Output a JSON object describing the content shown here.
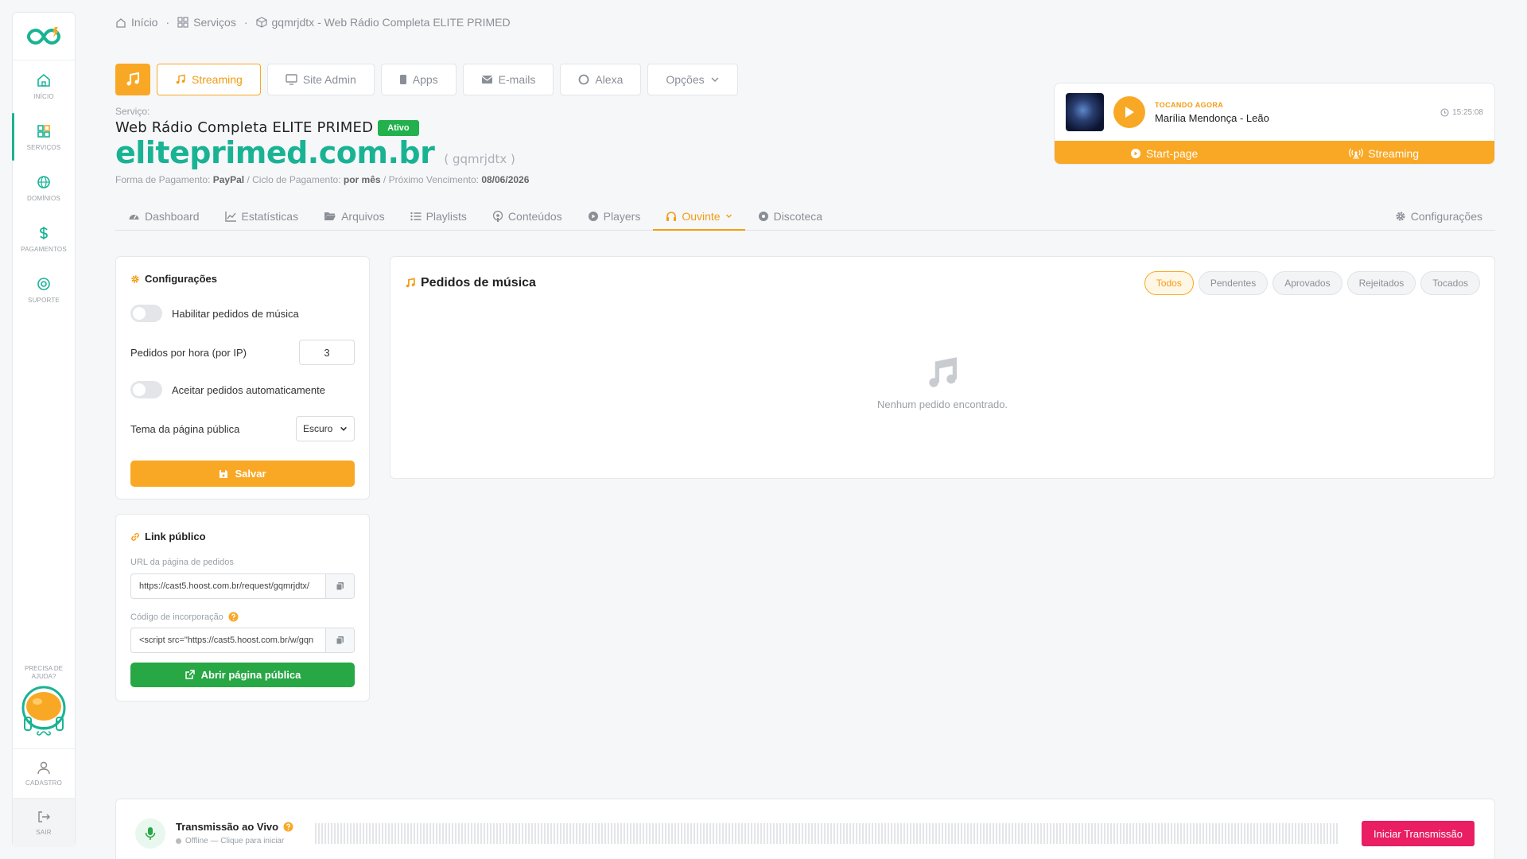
{
  "sidebar": {
    "nav": [
      {
        "label": "INÍCIO",
        "icon": "home-icon"
      },
      {
        "label": "SERVIÇOS",
        "icon": "grid-icon"
      },
      {
        "label": "DOMÍNIOS",
        "icon": "globe-icon"
      },
      {
        "label": "PAGAMENTOS",
        "icon": "dollar-icon"
      },
      {
        "label": "SUPORTE",
        "icon": "lifebuoy-icon"
      }
    ],
    "help_line1": "PRECISA DE",
    "help_line2": "AJUDA?",
    "account_label": "CADASTRO",
    "logout_label": "SAIR"
  },
  "breadcrumb": {
    "home": "Início",
    "services": "Serviços",
    "current": "gqmrjdtx - Web Rádio Completa ELITE PRIMED"
  },
  "service_tabs": {
    "streaming": "Streaming",
    "site_admin": "Site Admin",
    "apps": "Apps",
    "emails": "E-mails",
    "alexa": "Alexa",
    "options": "Opções"
  },
  "service": {
    "label": "Serviço:",
    "name": "Web Rádio Completa ELITE PRIMED",
    "status": "Ativo",
    "domain": "eliteprimed.com.br",
    "username": "( gqmrjdtx )",
    "payment_label": "Forma de Pagamento:",
    "payment_value": "PayPal",
    "cycle_label": "/ Ciclo de Pagamento:",
    "cycle_value": "por mês",
    "due_label": "/ Próximo Vencimento:",
    "due_value": "08/06/2026"
  },
  "player": {
    "now_playing_label": "TOCANDO AGORA",
    "track": "Marília Mendonça - Leão",
    "time": "15:25:08",
    "start_page": "Start-page",
    "streaming": "Streaming"
  },
  "subtabs": {
    "dashboard": "Dashboard",
    "stats": "Estatísticas",
    "files": "Arquivos",
    "playlists": "Playlists",
    "contents": "Conteúdos",
    "players": "Players",
    "listener": "Ouvinte",
    "discoteca": "Discoteca",
    "settings": "Configurações"
  },
  "config": {
    "title": "Configurações",
    "enable_requests": "Habilitar pedidos de música",
    "enable_requests_on": false,
    "per_hour_label": "Pedidos por hora (por IP)",
    "per_hour_value": "3",
    "auto_accept": "Aceitar pedidos automaticamente",
    "auto_accept_on": false,
    "theme_label": "Tema da página pública",
    "theme_value": "Escuro",
    "save": "Salvar"
  },
  "public_link": {
    "title": "Link público",
    "url_label": "URL da página de pedidos",
    "url_value": "https://cast5.hoost.com.br/request/gqmrjdtx/",
    "embed_label": "Código de incorporação",
    "embed_value": "<script src=\"https://cast5.hoost.com.br/w/gqn",
    "open": "Abrir página pública"
  },
  "requests": {
    "title": "Pedidos de música",
    "filters": [
      "Todos",
      "Pendentes",
      "Aprovados",
      "Rejeitados",
      "Tocados"
    ],
    "active_filter": "Todos",
    "empty": "Nenhum pedido encontrado."
  },
  "live": {
    "title": "Transmissão ao Vivo",
    "status": "Offline — Clique para iniciar",
    "button": "Iniciar Transmissão"
  },
  "colors": {
    "accent": "#f9a825",
    "brand": "#19b394",
    "success": "#28a745",
    "live": "#e91e63"
  }
}
